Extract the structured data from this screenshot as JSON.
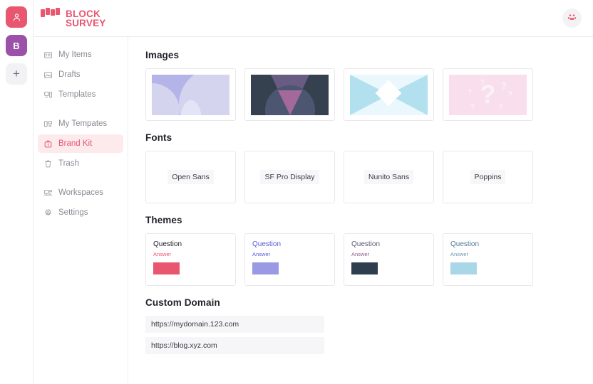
{
  "brand": {
    "line1": "BLOCK",
    "line2": "SURVEY",
    "color": "#e8566f",
    "mark_icon": "blocks-grid-icon"
  },
  "rail": {
    "items": [
      {
        "name": "user-avatar",
        "label": "",
        "icon": "person-icon",
        "color": "#e8566f"
      },
      {
        "name": "workspace-badge-b",
        "label": "B",
        "icon": "",
        "color": "#9b51aa"
      },
      {
        "name": "add-workspace",
        "label": "+",
        "icon": "plus-icon",
        "color": "#f2f2f4"
      }
    ]
  },
  "topbar": {
    "right_button_icon": "blocks-group-icon",
    "right_button_label": ""
  },
  "sidebar": {
    "groups": [
      {
        "items": [
          {
            "label": "My Items",
            "icon": "list-items-icon",
            "active": false
          },
          {
            "label": "Drafts",
            "icon": "image-draft-icon",
            "active": false
          },
          {
            "label": "Templates",
            "icon": "layout-template-icon",
            "active": false
          }
        ]
      },
      {
        "items": [
          {
            "label": "My Tempates",
            "icon": "my-templates-icon",
            "active": false
          },
          {
            "label": "Brand Kit",
            "icon": "briefcase-icon",
            "active": true
          },
          {
            "label": "Trash",
            "icon": "trash-icon",
            "active": false
          }
        ]
      },
      {
        "items": [
          {
            "label": "Workspaces",
            "icon": "workspaces-icon",
            "active": false
          },
          {
            "label": "Settings",
            "icon": "gear-icon",
            "active": false
          }
        ]
      }
    ]
  },
  "sections": {
    "images": {
      "title": "Images",
      "items": [
        {
          "name": "image-thumb-periwinkle-arcs",
          "alt": ""
        },
        {
          "name": "image-thumb-navy-triangle",
          "alt": ""
        },
        {
          "name": "image-thumb-blue-envelope",
          "alt": ""
        },
        {
          "name": "image-thumb-pink-questions",
          "alt": ""
        }
      ]
    },
    "fonts": {
      "title": "Fonts",
      "items": [
        {
          "label": "Open Sans"
        },
        {
          "label": "SF Pro Display"
        },
        {
          "label": "Nunito Sans"
        },
        {
          "label": "Poppins"
        }
      ]
    },
    "themes": {
      "title": "Themes",
      "items": [
        {
          "question": "Question",
          "answer": "Answer",
          "question_color": "#22222a",
          "answer_color": "#e8566f",
          "swatch": "#e8566f"
        },
        {
          "question": "Question",
          "answer": "Answer",
          "question_color": "#5a5ad6",
          "answer_color": "#5a5ad6",
          "swatch": "#9a9ae4"
        },
        {
          "question": "Question",
          "answer": "Answer",
          "question_color": "#5b5b78",
          "answer_color": "#8a5d8a",
          "swatch": "#2f3e4e"
        },
        {
          "question": "Question",
          "answer": "Answer",
          "question_color": "#4f7a99",
          "answer_color": "#6d99b3",
          "swatch": "#a9d7e8"
        }
      ]
    },
    "custom_domain": {
      "title": "Custom Domain",
      "items": [
        {
          "url": "https://mydomain.123.com"
        },
        {
          "url": "https://blog.xyz.com"
        }
      ]
    }
  }
}
